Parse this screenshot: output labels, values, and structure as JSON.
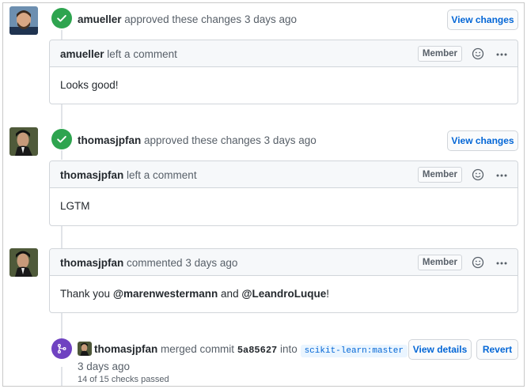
{
  "events": [
    {
      "author": "amueller",
      "action": "approved these changes",
      "time": "3 days ago",
      "button": "View changes",
      "comment": {
        "author": "amueller",
        "action": "left a comment",
        "badge": "Member",
        "body": "Looks good!"
      }
    },
    {
      "author": "thomasjpfan",
      "action": "approved these changes",
      "time": "3 days ago",
      "button": "View changes",
      "comment": {
        "author": "thomasjpfan",
        "action": "left a comment",
        "badge": "Member",
        "body": "LGTM"
      }
    }
  ],
  "comment3": {
    "author": "thomasjpfan",
    "action": "commented",
    "time": "3 days ago",
    "badge": "Member",
    "body_prefix": "Thank you",
    "mention1": "@marenwestermann",
    "conjunction": "and",
    "mention2": "@LeandroLuque",
    "body_suffix": "!"
  },
  "merge": {
    "author": "thomasjpfan",
    "action": "merged commit",
    "sha": "5a85627",
    "into": "into",
    "branch": "scikit-learn:master",
    "time": "3 days ago",
    "checks": "14 of 15 checks passed",
    "details_button": "View details",
    "revert_button": "Revert"
  },
  "icons": {
    "approved": "check-icon",
    "merge": "git-merge-icon",
    "emoji": "smiley-icon",
    "more": "kebab-horizontal-icon"
  },
  "colors": {
    "approved": "#2ea44f",
    "merged": "#6f42c1",
    "link": "#0366d6"
  }
}
